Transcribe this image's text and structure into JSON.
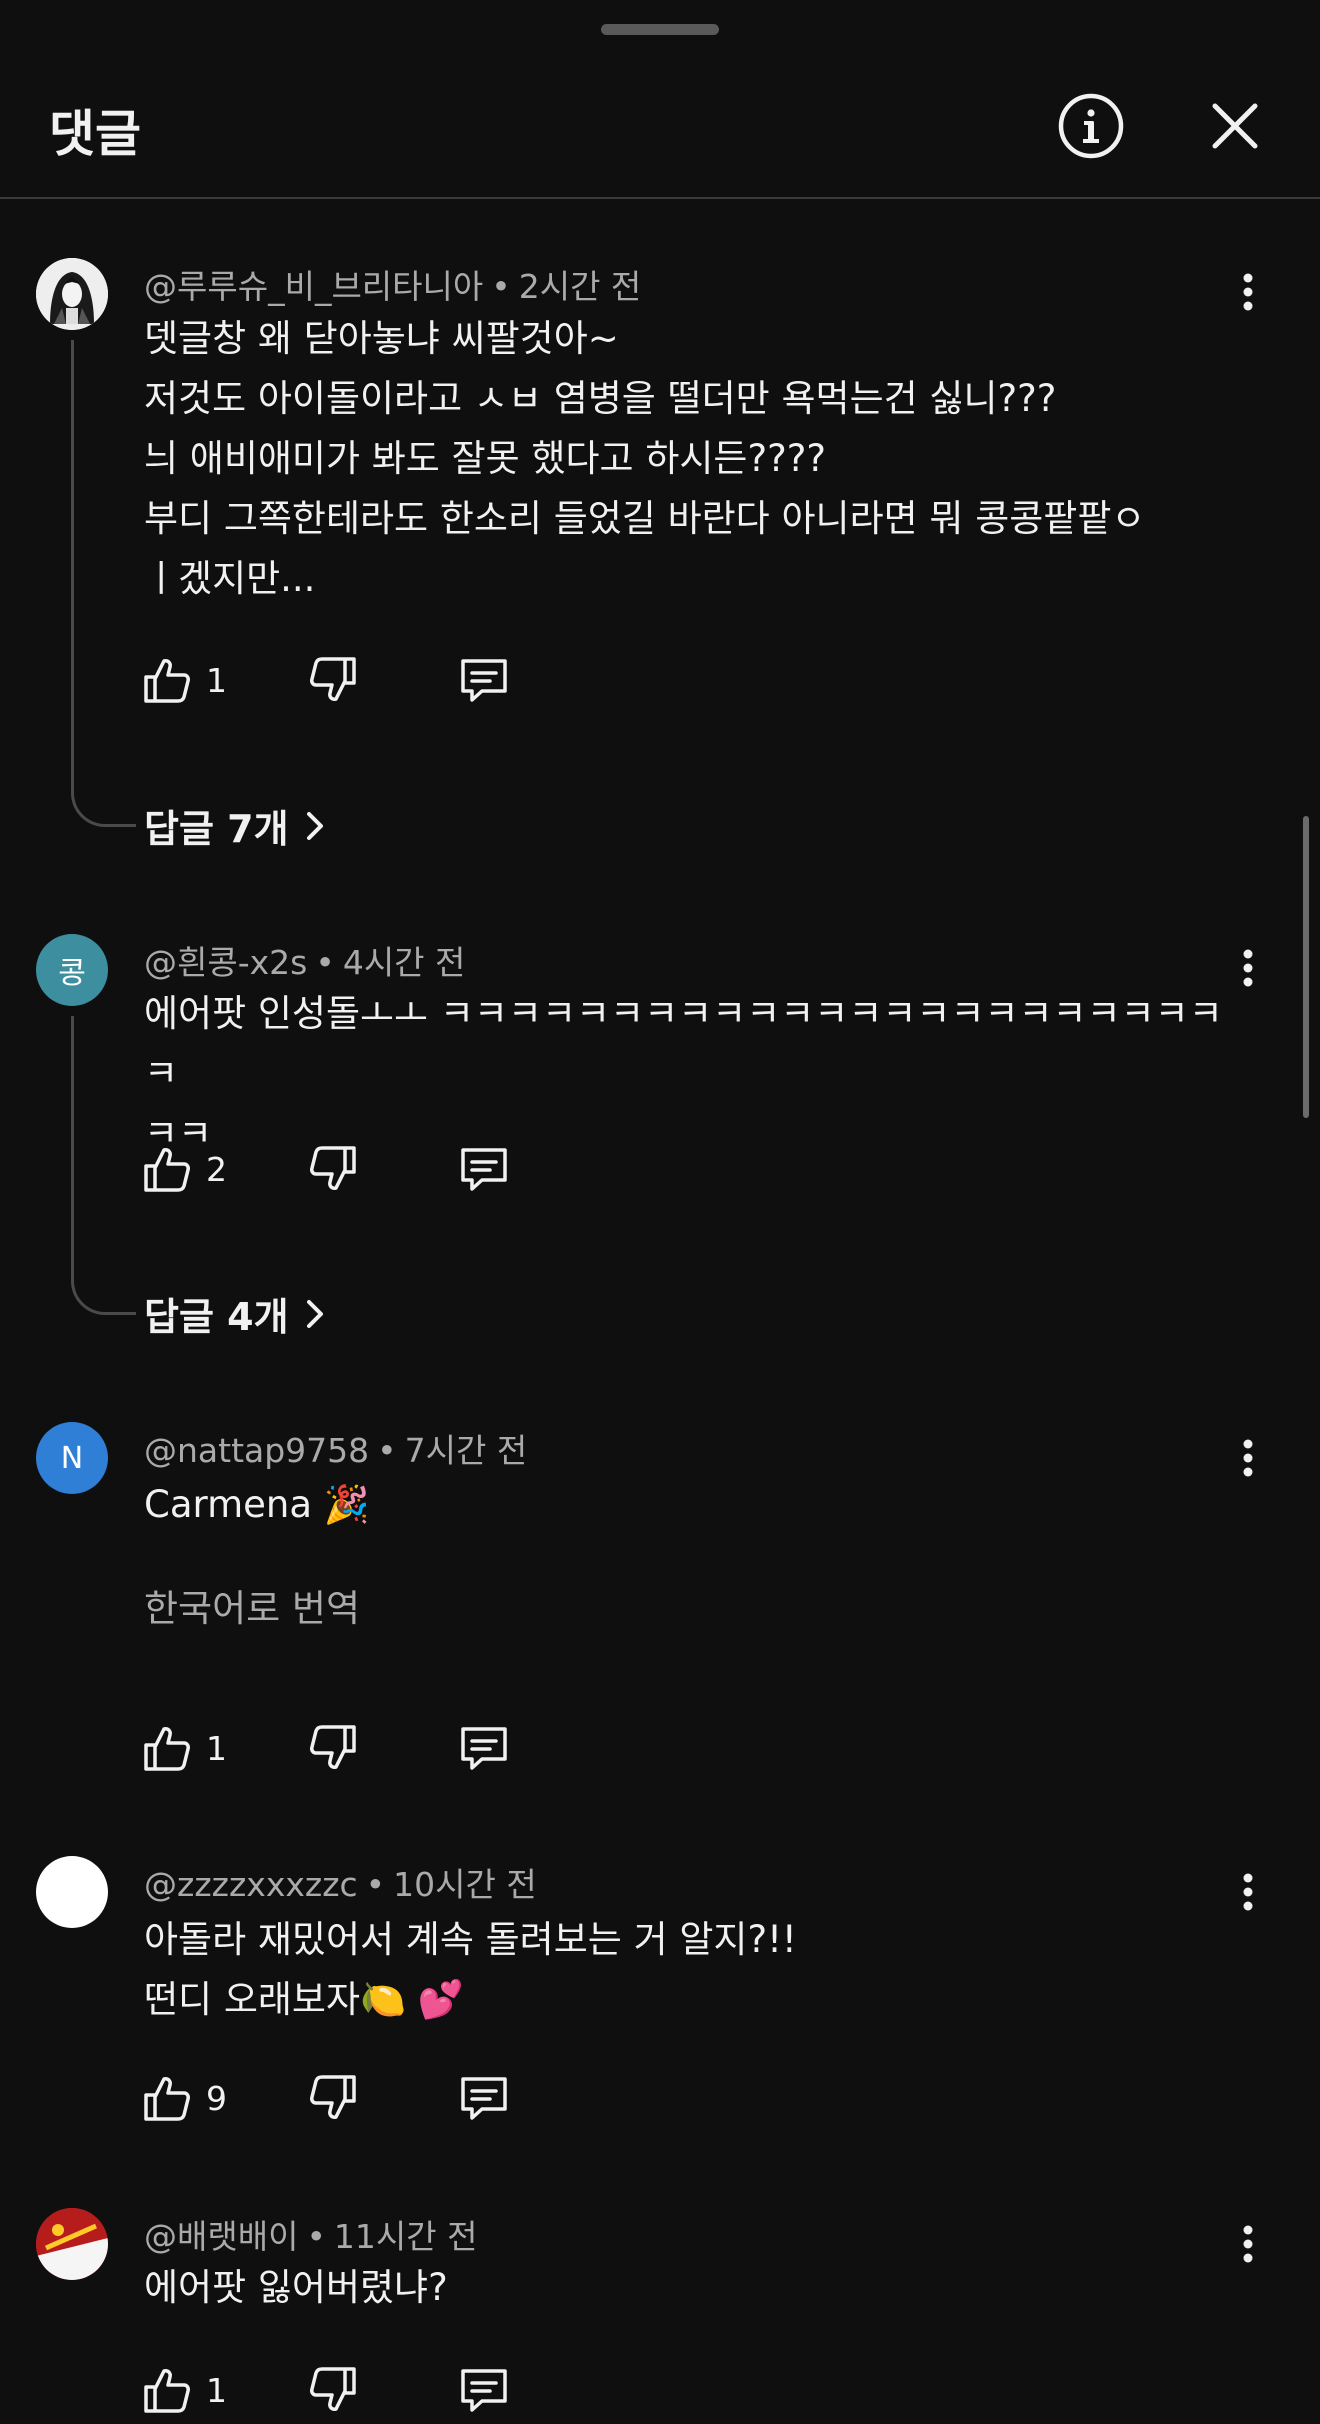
{
  "header": {
    "title": "댓글",
    "info_icon": "info-icon",
    "close_icon": "close-icon"
  },
  "colors": {
    "background": "#0f0f0f",
    "text_primary": "#f1f1f1",
    "text_secondary": "#aaaaaa"
  },
  "comments": [
    {
      "author": "@루루슈_비_브리타니아",
      "time": "2시간 전",
      "text": "뎃글창 왜 닫아놓냐 씨팔것아~\n저것도 아이돌이라고 ㅅㅂ 염병을 떨더만 욕먹는건 싫니???\n늬 애비애미가 봐도 잘못 했다고 하시든????\n부디 그쪽한테라도 한소리 들었길 바란다 아니라면 뭐 콩콩팥팥ㅇ\nㅣ겠지만...",
      "likes": "1",
      "replies": "답글 7개",
      "avatar": "anime-avatar"
    },
    {
      "author": "@흰콩-x2s",
      "time": "4시간 전",
      "text": "에어팟 인성돌ㅗㅗ ㅋㅋㅋㅋㅋㅋㅋㅋㅋㅋㅋㅋㅋㅋㅋㅋㅋㅋㅋㅋㅋㅋㅋㅋ\nㅋㅋ",
      "likes": "2",
      "replies": "답글 4개",
      "avatar_letter": "콩",
      "avatar_color": "#3d8fa0"
    },
    {
      "author": "@nattap9758",
      "time": "7시간 전",
      "text": "Carmena 🎉",
      "translate": "한국어로 번역",
      "likes": "1",
      "avatar_letter": "N",
      "avatar_color": "#2f7fd6"
    },
    {
      "author": "@zzzzxxxzzc",
      "time": "10시간 전",
      "text": "아돌라 재밌어서 계속 돌려보는 거 알지?!!\n떤디 오래보자🍋 💕",
      "likes": "9",
      "avatar_color": "#ffffff"
    },
    {
      "author": "@배랫배이",
      "time": "11시간 전",
      "text": "에어팟 잃어버렸냐?",
      "likes": "1",
      "avatar": "flag-avatar"
    }
  ]
}
